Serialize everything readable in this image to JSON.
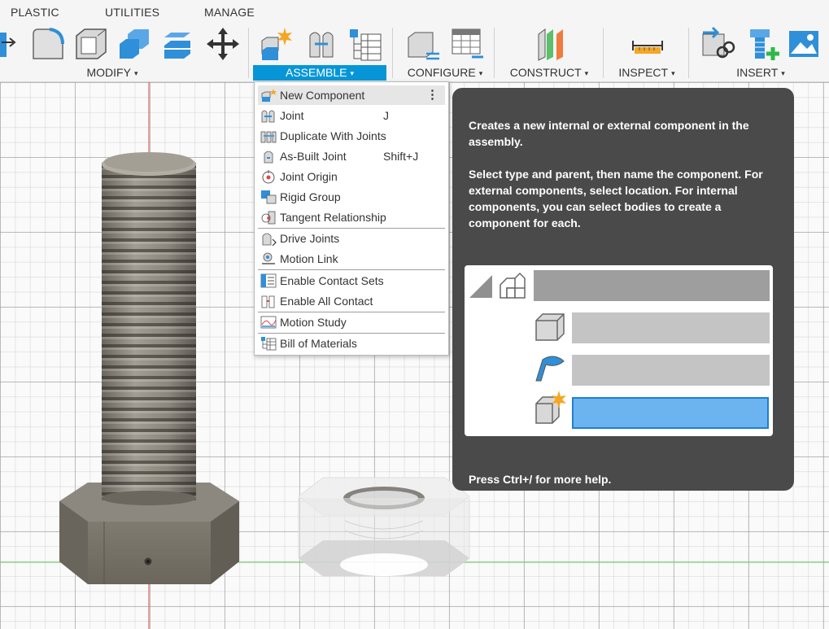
{
  "toolbar": {
    "tabs": [
      {
        "label": "PLASTIC"
      },
      {
        "label": "UTILITIES"
      },
      {
        "label": "MANAGE"
      }
    ],
    "groups": [
      {
        "label": "MODIFY",
        "caret": "▾"
      },
      {
        "label": "ASSEMBLE",
        "caret": "▾",
        "active": true
      },
      {
        "label": "CONFIGURE",
        "caret": "▾"
      },
      {
        "label": "CONSTRUCT",
        "caret": "▾"
      },
      {
        "label": "INSPECT",
        "caret": "▾"
      },
      {
        "label": "INSERT",
        "caret": "▾"
      }
    ],
    "colors": {
      "active_group": "#0696d7",
      "icon_blue": "#2f8fd8",
      "icon_grey": "#d9d9d9"
    }
  },
  "assemble_menu": {
    "items": [
      {
        "label": "New Component",
        "shortcut": "",
        "icon": "new-component-icon",
        "highlighted": true,
        "more": "⋮"
      },
      {
        "label": "Joint",
        "shortcut": "J",
        "icon": "joint-icon"
      },
      {
        "label": "Duplicate With Joints",
        "shortcut": "",
        "icon": "duplicate-with-joints-icon"
      },
      {
        "label": "As-Built Joint",
        "shortcut": "Shift+J",
        "icon": "as-built-joint-icon"
      },
      {
        "label": "Joint Origin",
        "shortcut": "",
        "icon": "joint-origin-icon"
      },
      {
        "label": "Rigid Group",
        "shortcut": "",
        "icon": "rigid-group-icon"
      },
      {
        "label": "Tangent Relationship",
        "shortcut": "",
        "icon": "tangent-relationship-icon"
      },
      {
        "label": "Drive Joints",
        "shortcut": "",
        "icon": "drive-joints-icon"
      },
      {
        "label": "Motion Link",
        "shortcut": "",
        "icon": "motion-link-icon"
      },
      {
        "label": "Enable Contact Sets",
        "shortcut": "",
        "icon": "enable-contact-sets-icon"
      },
      {
        "label": "Enable All Contact",
        "shortcut": "",
        "icon": "enable-all-contact-icon"
      },
      {
        "label": "Motion Study",
        "shortcut": "",
        "icon": "motion-study-icon"
      },
      {
        "label": "Bill of Materials",
        "shortcut": "",
        "icon": "bill-of-materials-icon"
      }
    ]
  },
  "tooltip": {
    "title": "Creates a new internal or external component in the assembly.",
    "body": "Select type and parent, then name the component. For external components, select location. For internal components, you can select bodies to create a component for each.",
    "footer": "Press Ctrl+/ for more help.",
    "colors": {
      "background": "#4a4a4a",
      "highlight_field": "#6cb4f0"
    }
  },
  "viewport": {
    "objects": [
      "hex-bolt",
      "hex-nut"
    ],
    "colors": {
      "x_axis": "#e06868",
      "y_axis": "#7ad07a",
      "grid": "#bdbdbd",
      "bolt": "#8a857b"
    }
  }
}
